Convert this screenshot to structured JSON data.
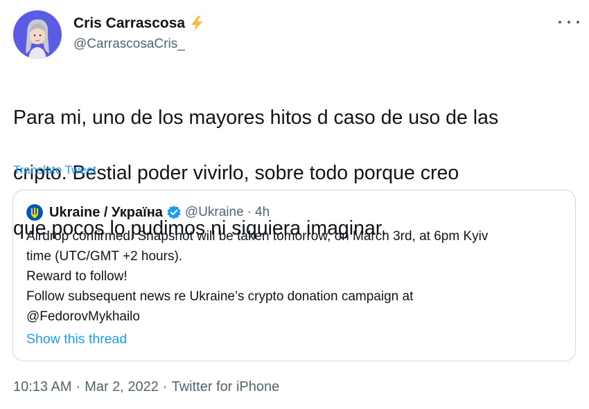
{
  "author": {
    "display_name": "Cris Carrascosa",
    "handle": "@CarrascosaCris_",
    "badge_icon": "lightning-bolt-emoji"
  },
  "tweet": {
    "text_lines": [
      "Para mi, uno de los mayores hitos d caso de uso de las",
      "cripto. Bestial poder vivirlo, sobre todo porque creo",
      "que pocos lo pudimos ni siquiera imaginar."
    ],
    "translate_label": "Translate Tweet"
  },
  "quoted_tweet": {
    "display_name": "Ukraine / Україна",
    "handle": "@Ukraine",
    "separator": "·",
    "time": "4h",
    "verified_icon": "verified-badge-icon",
    "body_lines": [
      "Airdrop confirmed. Snapshot will be taken tomorrow, on March 3rd, at 6pm Kyiv",
      "time (UTC/GMT +2 hours).",
      "Reward to follow!",
      "Follow subsequent news re Ukraine’s crypto donation campaign at",
      "@FedorovMykhailo"
    ],
    "show_thread_label": "Show this thread"
  },
  "meta": {
    "time": "10:13 AM",
    "separator": "·",
    "date": "Mar 2, 2022",
    "source": "Twitter for iPhone"
  },
  "colors": {
    "link_blue": "#1d9bf0",
    "secondary_text": "#536471",
    "border": "#cfd9de",
    "avatar_bg": "#5b5be8",
    "ukraine_blue": "#0057b7",
    "ukraine_yellow": "#ffd700"
  }
}
